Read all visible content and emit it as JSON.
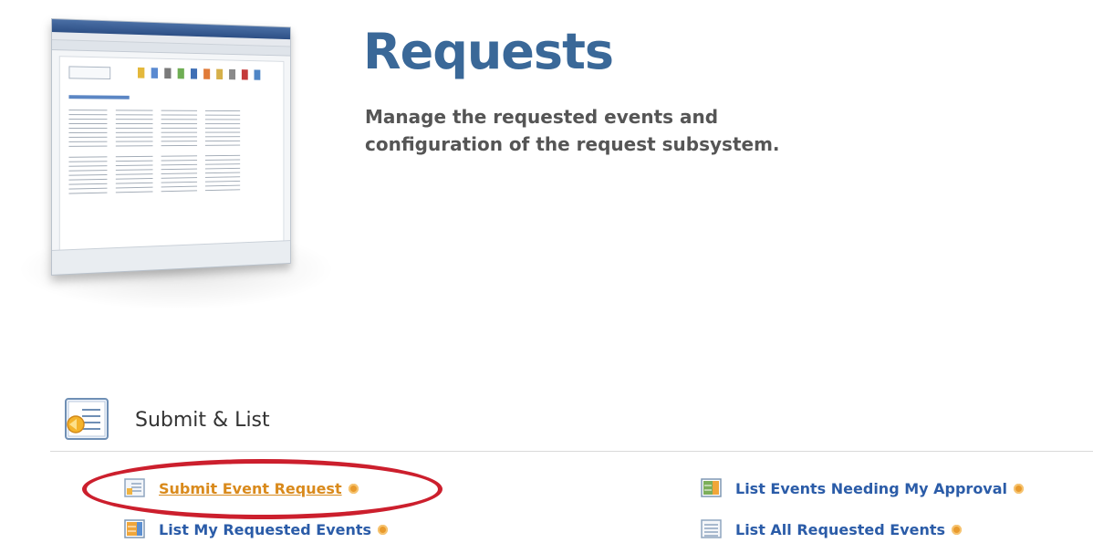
{
  "header": {
    "title": "Requests",
    "subtitle_line1": "Manage the requested events and",
    "subtitle_line2": "configuration of the request subsystem."
  },
  "section": {
    "title": "Submit & List",
    "links": [
      {
        "label": "Submit Event Request",
        "icon": "form-icon",
        "active": true
      },
      {
        "label": "List My Requested Events",
        "icon": "calendar-list-icon",
        "active": false
      },
      {
        "label": "List Events Needing My Approval",
        "icon": "approval-icon",
        "active": false
      },
      {
        "label": "List All Requested Events",
        "icon": "list-icon",
        "active": false
      }
    ]
  },
  "colors": {
    "title": "#3a6898",
    "link": "#2b5ca8",
    "active_link": "#d98a1c",
    "annotation": "#cc1f2d"
  }
}
